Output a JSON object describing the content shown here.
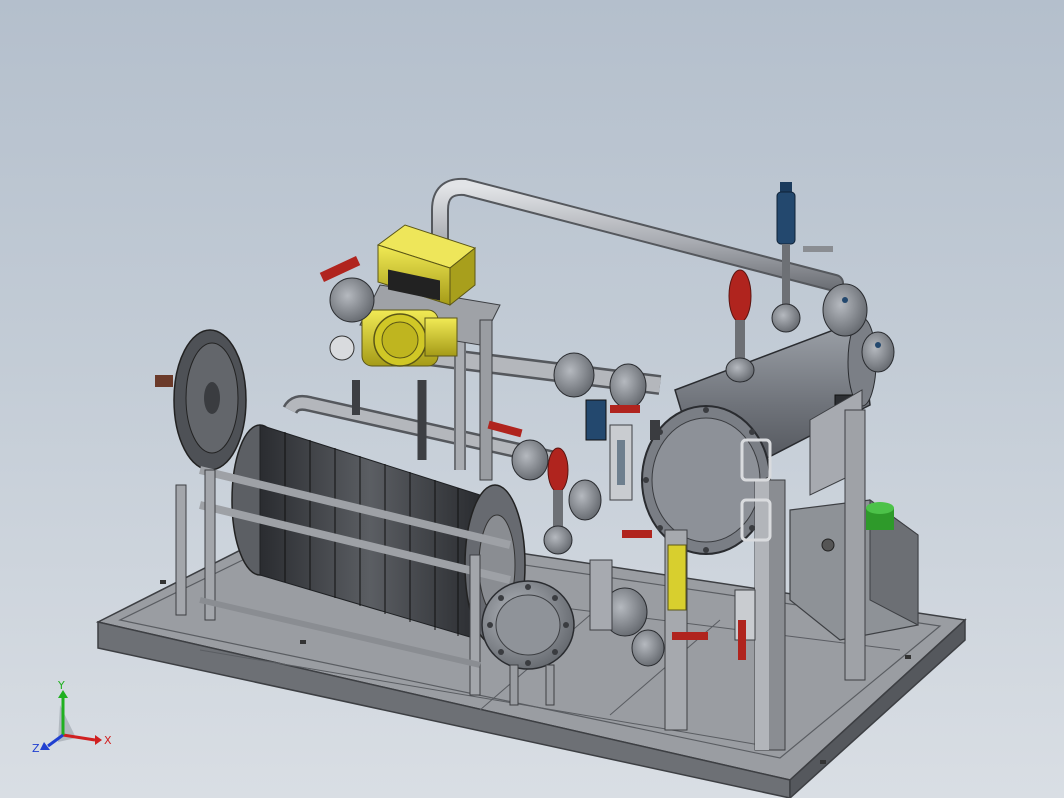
{
  "viewport": {
    "background_top": "#b4bfcc",
    "background_bottom": "#d9dee4"
  },
  "model": {
    "name": "",
    "components": [
      "base-skid-frame",
      "hose-reel",
      "horizontal-vessel",
      "flow-meter",
      "piping-loop",
      "ball-valves",
      "safety-relief-valves",
      "sight-glasses",
      "end-flange",
      "control-box",
      "green-indicator-lamp"
    ]
  },
  "colors": {
    "steel": "#8a8e94",
    "steel_dark": "#4a4d52",
    "pipe": "#a9acb1",
    "meter_yellow": "#d8cf2e",
    "valve_red": "#b0241e",
    "valve_blue": "#23486e",
    "lamp_green": "#2e9a2a"
  },
  "triad": {
    "x_label": "X",
    "y_label": "Y",
    "z_label": "Z",
    "x_color": "#d02020",
    "y_color": "#20b020",
    "z_color": "#2040d0"
  }
}
